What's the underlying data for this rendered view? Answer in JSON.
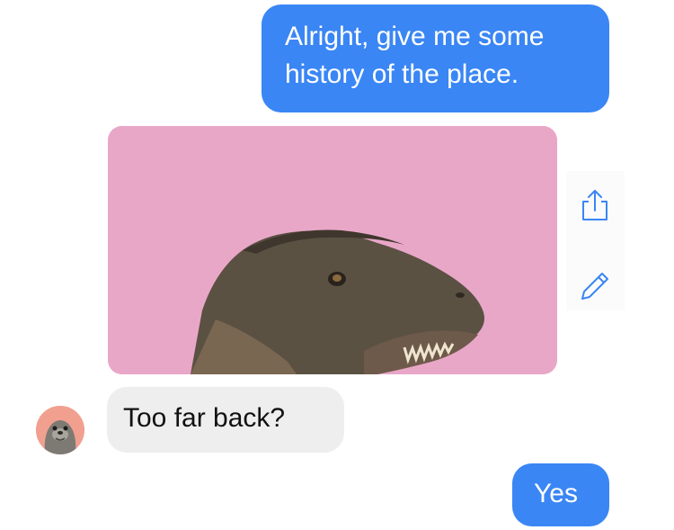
{
  "conversation": {
    "messages": [
      {
        "sender": "me",
        "type": "text",
        "text": "Alright, give me some history of the place."
      },
      {
        "sender": "me",
        "type": "gif",
        "icon": "t-rex-animation"
      },
      {
        "sender": "contact",
        "type": "text",
        "text": "Too far back?"
      },
      {
        "sender": "me",
        "type": "text",
        "text": "Yes"
      }
    ]
  },
  "actions": [
    {
      "icon": "share-icon"
    },
    {
      "icon": "edit-pencil-icon"
    }
  ],
  "contact": {
    "avatar_icon": "seal-avatar"
  },
  "colors": {
    "outgoing_bubble": "#3a86f4",
    "incoming_bubble": "#eeeeef",
    "gif_background": "#e9a7c8",
    "action_icon": "#3a86f4",
    "avatar_background": "#f1a090"
  }
}
